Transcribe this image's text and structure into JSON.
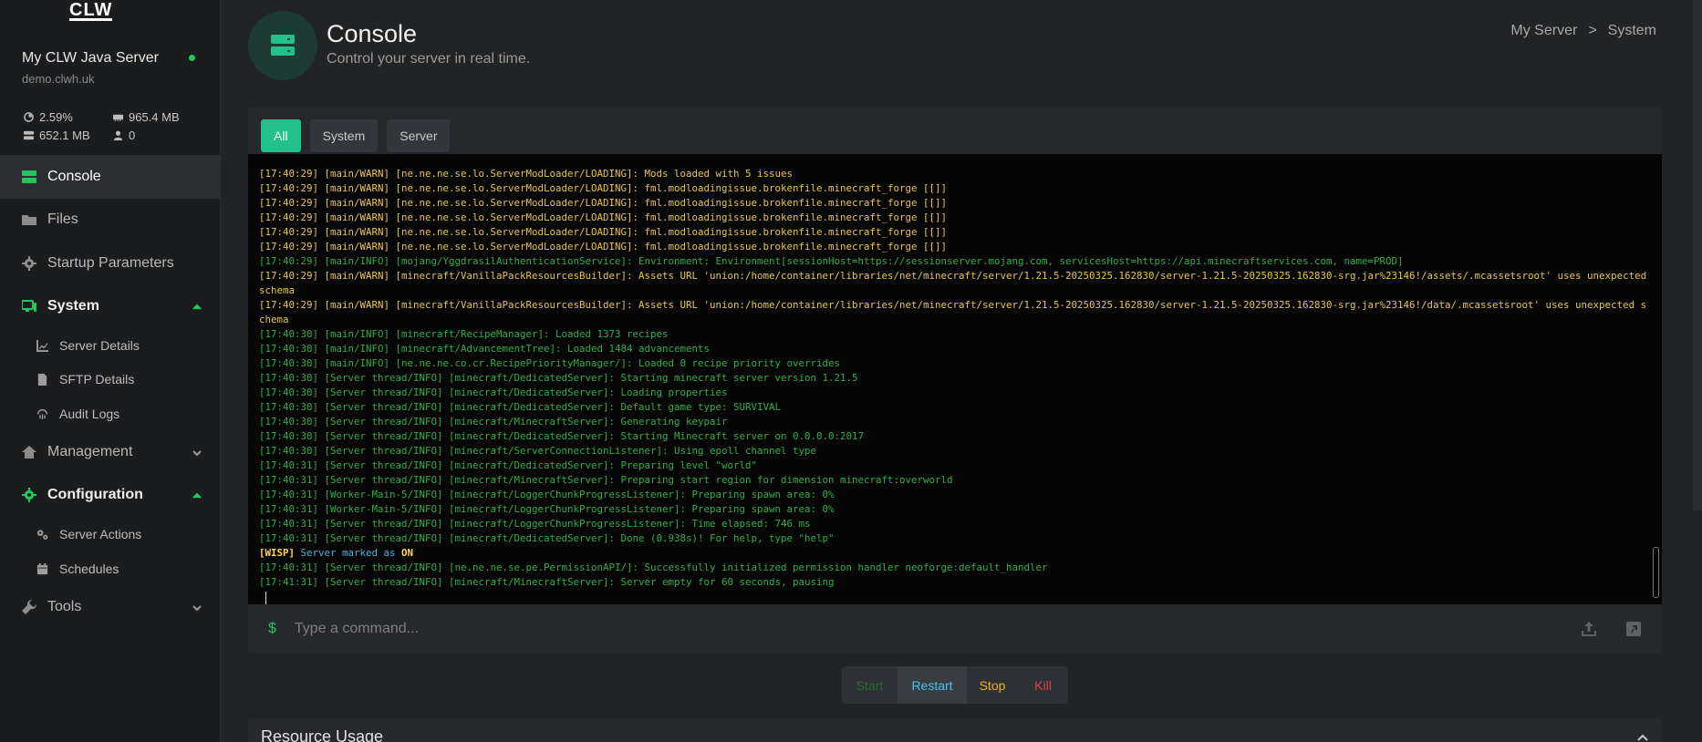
{
  "sidebar": {
    "logo": "CLW",
    "server_name": "My CLW Java Server",
    "server_host": "demo.clwh.uk",
    "stats": {
      "cpu": "2.59%",
      "memory": "965.4 MB",
      "disk": "652.1 MB",
      "players": "0"
    },
    "nav": {
      "console": "Console",
      "files": "Files",
      "startup": "Startup Parameters",
      "system": "System",
      "server_details": "Server Details",
      "sftp_details": "SFTP Details",
      "audit_logs": "Audit Logs",
      "management": "Management",
      "configuration": "Configuration",
      "server_actions": "Server Actions",
      "schedules": "Schedules",
      "tools": "Tools"
    }
  },
  "header": {
    "title": "Console",
    "subtitle": "Control your server in real time.",
    "breadcrumb": [
      "My Server",
      ">",
      "System"
    ]
  },
  "console": {
    "tabs": [
      "All",
      "System",
      "Server"
    ],
    "lines": [
      {
        "type": "warn",
        "text": "[17:40:29] [main/WARN] [ne.ne.ne.se.lo.ServerModLoader/LOADING]: Mods loaded with 5 issues"
      },
      {
        "type": "warn",
        "text": "[17:40:29] [main/WARN] [ne.ne.ne.se.lo.ServerModLoader/LOADING]: fml.modloadingissue.brokenfile.minecraft_forge [[]]"
      },
      {
        "type": "warn",
        "text": "[17:40:29] [main/WARN] [ne.ne.ne.se.lo.ServerModLoader/LOADING]: fml.modloadingissue.brokenfile.minecraft_forge [[]]"
      },
      {
        "type": "warn",
        "text": "[17:40:29] [main/WARN] [ne.ne.ne.se.lo.ServerModLoader/LOADING]: fml.modloadingissue.brokenfile.minecraft_forge [[]]"
      },
      {
        "type": "warn",
        "text": "[17:40:29] [main/WARN] [ne.ne.ne.se.lo.ServerModLoader/LOADING]: fml.modloadingissue.brokenfile.minecraft_forge [[]]"
      },
      {
        "type": "warn",
        "text": "[17:40:29] [main/WARN] [ne.ne.ne.se.lo.ServerModLoader/LOADING]: fml.modloadingissue.brokenfile.minecraft_forge [[]]"
      },
      {
        "type": "info",
        "text": "[17:40:29] [main/INFO] [mojang/YggdrasilAuthenticationService]: Environment: Environment[sessionHost=https://sessionserver.mojang.com, servicesHost=https://api.minecraftservices.com, name=PROD]"
      },
      {
        "type": "warn",
        "text": "[17:40:29] [main/WARN] [minecraft/VanillaPackResourcesBuilder]: Assets URL 'union:/home/container/libraries/net/minecraft/server/1.21.5-20250325.162830/server-1.21.5-20250325.162830-srg.jar%23146!/assets/.mcassetsroot' uses unexpected schema"
      },
      {
        "type": "warn",
        "text": "[17:40:29] [main/WARN] [minecraft/VanillaPackResourcesBuilder]: Assets URL 'union:/home/container/libraries/net/minecraft/server/1.21.5-20250325.162830/server-1.21.5-20250325.162830-srg.jar%23146!/data/.mcassetsroot' uses unexpected schema"
      },
      {
        "type": "info",
        "text": "[17:40:30] [main/INFO] [minecraft/RecipeManager]: Loaded 1373 recipes"
      },
      {
        "type": "info",
        "text": "[17:40:30] [main/INFO] [minecraft/AdvancementTree]: Loaded 1484 advancements"
      },
      {
        "type": "info",
        "text": "[17:40:30] [main/INFO] [ne.ne.ne.co.cr.RecipePriorityManager/]: Loaded 0 recipe priority overrides"
      },
      {
        "type": "info",
        "text": "[17:40:30] [Server thread/INFO] [minecraft/DedicatedServer]: Starting minecraft server version 1.21.5"
      },
      {
        "type": "info",
        "text": "[17:40:30] [Server thread/INFO] [minecraft/DedicatedServer]: Loading properties"
      },
      {
        "type": "info",
        "text": "[17:40:30] [Server thread/INFO] [minecraft/DedicatedServer]: Default game type: SURVIVAL"
      },
      {
        "type": "info",
        "text": "[17:40:30] [Server thread/INFO] [minecraft/MinecraftServer]: Generating keypair"
      },
      {
        "type": "info",
        "text": "[17:40:30] [Server thread/INFO] [minecraft/DedicatedServer]: Starting Minecraft server on 0.0.0.0:2017"
      },
      {
        "type": "info",
        "text": "[17:40:30] [Server thread/INFO] [minecraft/ServerConnectionListener]: Using epoll channel type"
      },
      {
        "type": "info",
        "text": "[17:40:31] [Server thread/INFO] [minecraft/DedicatedServer]: Preparing level \"world\""
      },
      {
        "type": "info",
        "text": "[17:40:31] [Server thread/INFO] [minecraft/MinecraftServer]: Preparing start region for dimension minecraft:overworld"
      },
      {
        "type": "info",
        "text": "[17:40:31] [Worker-Main-5/INFO] [minecraft/LoggerChunkProgressListener]: Preparing spawn area: 0%"
      },
      {
        "type": "info",
        "text": "[17:40:31] [Worker-Main-5/INFO] [minecraft/LoggerChunkProgressListener]: Preparing spawn area: 0%"
      },
      {
        "type": "info",
        "text": "[17:40:31] [Server thread/INFO] [minecraft/LoggerChunkProgressListener]: Time elapsed: 746 ms"
      },
      {
        "type": "info",
        "text": "[17:40:31] [Server thread/INFO] [minecraft/DedicatedServer]: Done (0.938s)! For help, type \"help\""
      },
      {
        "type": "wisp",
        "tag": "[WISP]",
        "text": " Server marked as ",
        "state": "ON"
      },
      {
        "type": "info",
        "text": "[17:40:31] [Server thread/INFO] [ne.ne.ne.se.pe.PermissionAPI/]: Successfully initialized permission handler neoforge:default_handler"
      },
      {
        "type": "info",
        "text": "[17:41:31] [Server thread/INFO] [minecraft/MinecraftServer]: Server empty for 60 seconds, pausing"
      }
    ],
    "prompt": "$",
    "input_placeholder": "Type a command..."
  },
  "power": {
    "start": "Start",
    "restart": "Restart",
    "stop": "Stop",
    "kill": "Kill"
  },
  "resource": {
    "title": "Resource Usage"
  },
  "colors": {
    "accent": "#22c08a",
    "warn": "#e8c54a",
    "info": "#2fae47",
    "online": "#22c55e"
  }
}
